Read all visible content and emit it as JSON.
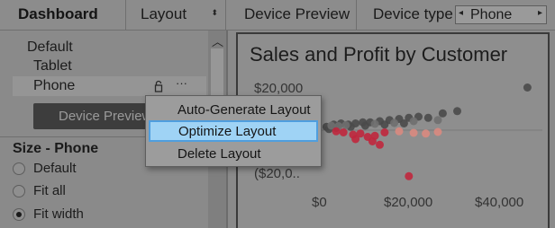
{
  "topbar": {
    "dashboard_tab": "Dashboard",
    "layout_tab": "Layout",
    "layout_arrow": "⬍",
    "device_preview_tab": "Device Preview",
    "device_type_label": "Device type",
    "device_type_value": "Phone"
  },
  "layouts": {
    "items": [
      "Default",
      "Tablet",
      "Phone"
    ],
    "selected": "Phone",
    "device_preview_button": "Device Preview"
  },
  "size": {
    "title": "Size - Phone",
    "options": [
      "Default",
      "Fit all",
      "Fit width"
    ],
    "selected": "Fit width"
  },
  "context_menu": {
    "items": [
      "Auto-Generate Layout",
      "Optimize Layout",
      "Delete Layout"
    ],
    "highlighted": "Optimize Layout"
  },
  "chart_data": {
    "type": "scatter",
    "title": "Sales and Profit by Customer",
    "y_ticks": [
      "$20,000",
      "$0",
      "($20,0.."
    ],
    "x_ticks": [
      "$0",
      "$20,000",
      "$40,000"
    ],
    "xlim": [
      -3000,
      45000
    ],
    "ylim": [
      -25000,
      25000
    ],
    "series": [
      {
        "color": "#4a4a4a",
        "points": [
          [
            1000,
            1500
          ],
          [
            2500,
            2500
          ],
          [
            4000,
            3000
          ],
          [
            5500,
            2500
          ],
          [
            7000,
            3000
          ],
          [
            8500,
            3500
          ],
          [
            10000,
            3500
          ],
          [
            12000,
            4000
          ],
          [
            14000,
            4500
          ],
          [
            16000,
            5000
          ],
          [
            18000,
            5500
          ],
          [
            20000,
            6000
          ],
          [
            22000,
            5500
          ],
          [
            25000,
            7500
          ],
          [
            28000,
            8500
          ],
          [
            1500,
            500
          ],
          [
            3000,
            1000
          ],
          [
            6000,
            1500
          ],
          [
            9000,
            2000
          ],
          [
            13000,
            2500
          ],
          [
            17000,
            3000
          ],
          [
            42500,
            19000
          ]
        ]
      },
      {
        "color": "#6f6f6f",
        "points": [
          [
            2000,
            2000
          ],
          [
            3500,
            1800
          ],
          [
            5000,
            2200
          ],
          [
            11000,
            2800
          ],
          [
            15000,
            3200
          ],
          [
            19000,
            4000
          ],
          [
            24000,
            4500
          ]
        ]
      },
      {
        "color": "#c0273d",
        "points": [
          [
            3000,
            -500
          ],
          [
            4500,
            -1000
          ],
          [
            6500,
            -2000
          ],
          [
            8000,
            -1500
          ],
          [
            9500,
            -3000
          ],
          [
            11000,
            -2500
          ],
          [
            13000,
            -1000
          ],
          [
            7000,
            -4000
          ],
          [
            10500,
            -5000
          ],
          [
            12000,
            -6500
          ],
          [
            18000,
            -20500
          ]
        ]
      },
      {
        "color": "#d98a80",
        "points": [
          [
            16000,
            -500
          ],
          [
            19000,
            -1200
          ],
          [
            21500,
            -1500
          ],
          [
            24000,
            -800
          ]
        ]
      }
    ]
  }
}
